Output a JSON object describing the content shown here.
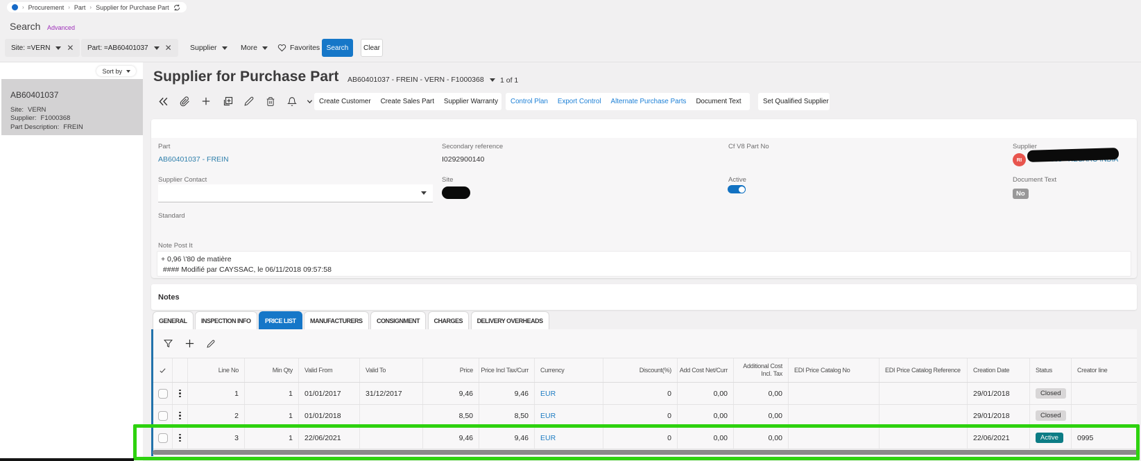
{
  "breadcrumb": {
    "items": [
      "Procurement",
      "Part",
      "Supplier for Purchase Part"
    ]
  },
  "search": {
    "title": "Search",
    "advanced_label": "Advanced",
    "filters": [
      {
        "label": "Site: =VERN"
      },
      {
        "label": "Part: =AB60401037"
      }
    ],
    "menus": [
      {
        "label": "Supplier"
      },
      {
        "label": "More"
      }
    ],
    "favorites_label": "Favorites",
    "search_button": "Search",
    "clear_button": "Clear"
  },
  "sidebar": {
    "sort_by_label": "Sort by",
    "selected_item": {
      "title": "AB60401037",
      "fields": [
        {
          "label": "Site:",
          "value": "VERN"
        },
        {
          "label": "Supplier:",
          "value": "F1000368"
        },
        {
          "label": "Part Description:",
          "value": "FREIN"
        }
      ]
    }
  },
  "header": {
    "title": "Supplier for Purchase Part",
    "record": "AB60401037 - FREIN - VERN - F1000368",
    "pager": "1 of 1",
    "action_groups": {
      "group1": [
        {
          "label": "Create Customer"
        },
        {
          "label": "Create Sales Part"
        },
        {
          "label": "Supplier Warranty"
        }
      ],
      "group2": [
        {
          "label": "Control Plan"
        },
        {
          "label": "Export Control"
        },
        {
          "label": "Alternate Purchase Parts"
        },
        {
          "label": "Document Text"
        }
      ],
      "group3": [
        {
          "label": "Set Qualified Supplier"
        }
      ]
    }
  },
  "form": {
    "part": {
      "label": "Part",
      "value": "AB60401037 - FREIN"
    },
    "secondary_reference": {
      "label": "Secondary reference",
      "value": "I0292900140"
    },
    "cf_v8_part_no": {
      "label": "Cf V8 Part No",
      "value": ""
    },
    "supplier": {
      "label": "Supplier",
      "avatar_initials": "RI",
      "avatar_color": "#e8554e",
      "value": "F1000368 - RECARO INDIA",
      "redacted": true
    },
    "supplier_contact": {
      "label": "Supplier Contact",
      "value": ""
    },
    "site": {
      "label": "Site",
      "value": "",
      "redacted": true
    },
    "active": {
      "label": "Active",
      "value": true
    },
    "document_text": {
      "label": "Document Text",
      "value": "No"
    },
    "standard": {
      "label": "Standard",
      "value": ""
    },
    "note_post_it": {
      "label": "Note Post It",
      "lines": [
        "+ 0,96 \\'80 de matière",
        " #### Modifié par CAYSSAC, le 06/11/2018 09:57:58"
      ]
    }
  },
  "notes": {
    "label": "Notes"
  },
  "tabs": [
    {
      "label": "GENERAL"
    },
    {
      "label": "INSPECTION INFO"
    },
    {
      "label": "PRICE LIST",
      "active": true
    },
    {
      "label": "MANUFACTURERS"
    },
    {
      "label": "CONSIGNMENT"
    },
    {
      "label": "CHARGES"
    },
    {
      "label": "DELIVERY OVERHEADS"
    }
  ],
  "price_list": {
    "columns": {
      "select": "",
      "menu": "",
      "line_no": "Line No",
      "min_qty": "Min Qty",
      "valid_from": "Valid From",
      "valid_to": "Valid To",
      "price": "Price",
      "price_incl_tax": "Price Incl Tax/Curr",
      "currency": "Currency",
      "discount": "Discount(%)",
      "add_cost": "Add Cost Net/Curr",
      "additional_cost": "Additional Cost\nIncl. Tax",
      "edi_no": "EDI Price Catalog No",
      "edi_ref": "EDI Price Catalog Reference",
      "creation_date": "Creation Date",
      "status": "Status",
      "creator": "Creator line"
    },
    "rows": [
      {
        "line_no": "1",
        "min_qty": "1",
        "valid_from": "01/01/2017",
        "valid_to": "31/12/2017",
        "price": "9,46",
        "price_incl_tax": "9,46",
        "currency": "EUR",
        "discount": "0",
        "add_cost": "0,00",
        "additional_cost": "0,00",
        "edi_no": "",
        "edi_ref": "",
        "creation_date": "29/01/2018",
        "status": "Closed",
        "creator": ""
      },
      {
        "line_no": "2",
        "min_qty": "1",
        "valid_from": "01/01/2018",
        "valid_to": "",
        "price": "8,50",
        "price_incl_tax": "8,50",
        "currency": "EUR",
        "discount": "0",
        "add_cost": "0,00",
        "additional_cost": "0,00",
        "edi_no": "",
        "edi_ref": "",
        "creation_date": "29/01/2018",
        "status": "Closed",
        "creator": ""
      },
      {
        "line_no": "3",
        "min_qty": "1",
        "valid_from": "22/06/2021",
        "valid_to": "",
        "price": "9,46",
        "price_incl_tax": "9,46",
        "currency": "EUR",
        "discount": "0",
        "add_cost": "0,00",
        "additional_cost": "0,00",
        "edi_no": "",
        "edi_ref": "",
        "creation_date": "22/06/2021",
        "status": "Active",
        "creator": "0995"
      }
    ]
  },
  "annotation": {
    "color": "#2ed20f"
  }
}
